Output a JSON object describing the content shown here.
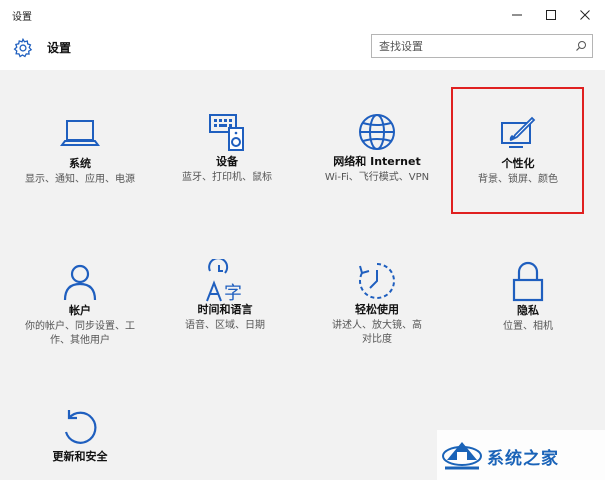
{
  "window": {
    "title": "设置",
    "controls": {
      "minimize": "–",
      "maximize": "☐",
      "close": "✕"
    }
  },
  "header": {
    "title": "设置",
    "search_placeholder": "查找设置",
    "icon": "gear-icon"
  },
  "categories": [
    {
      "name": "系统",
      "desc": "显示、通知、应用、电源",
      "icon": "laptop-icon"
    },
    {
      "name": "设备",
      "desc": "蓝牙、打印机、鼠标",
      "icon": "devices-icon"
    },
    {
      "name": "网络和 Internet",
      "desc": "Wi-Fi、飞行模式、VPN",
      "icon": "globe-icon"
    },
    {
      "name": "个性化",
      "desc": "背景、锁屏、颜色",
      "icon": "personalization-icon",
      "highlighted": true
    },
    {
      "name": "帐户",
      "desc": "你的帐户、同步设置、工作、其他用户",
      "icon": "person-icon"
    },
    {
      "name": "时间和语言",
      "desc": "语音、区域、日期",
      "icon": "time-language-icon"
    },
    {
      "name": "轻松使用",
      "desc": "讲述人、放大镜、高对比度",
      "icon": "ease-of-access-icon"
    },
    {
      "name": "隐私",
      "desc": "位置、相机",
      "icon": "lock-icon"
    },
    {
      "name": "更新和安全",
      "desc": "",
      "icon": "update-icon"
    }
  ],
  "watermark": {
    "text": "系统之家"
  },
  "colors": {
    "highlight": "#e02020",
    "background": "#f2f2f2",
    "watermark": "#1a63b8"
  }
}
